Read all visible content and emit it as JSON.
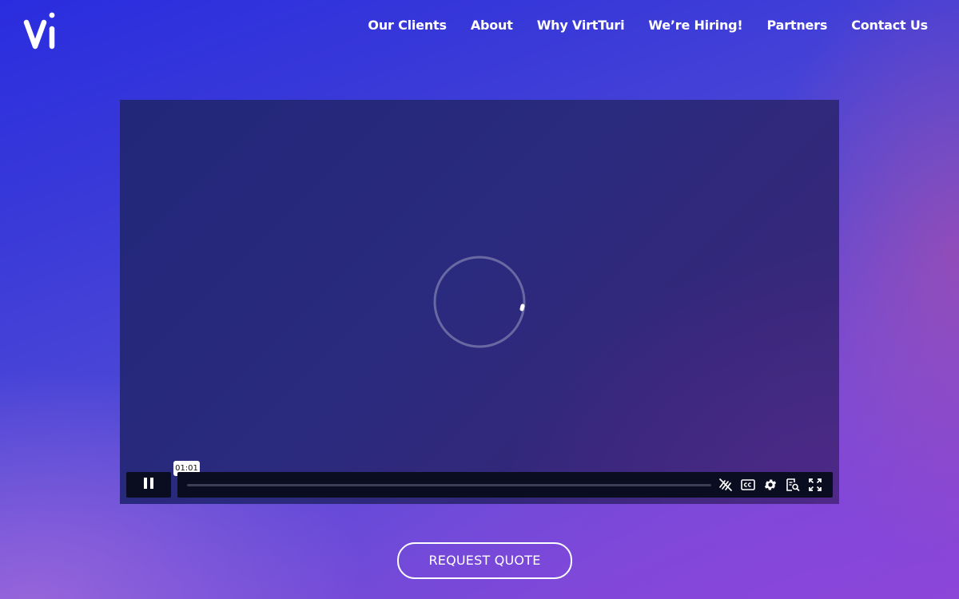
{
  "header": {
    "logo": {
      "text": "vi",
      "icon": "vi-logo"
    },
    "nav": [
      {
        "label": "Our Clients"
      },
      {
        "label": "About"
      },
      {
        "label": "Why VirtTuri"
      },
      {
        "label": "We’re Hiring!"
      },
      {
        "label": "Partners"
      },
      {
        "label": "Contact Us"
      }
    ]
  },
  "video": {
    "state": "loading",
    "loading_icon": "spinner-icon",
    "current_time": "01:01",
    "progress": 0.0,
    "controls": {
      "play_pause_icon": "pause-icon",
      "icons": [
        "reduced-motion-icon",
        "closed-captions-icon",
        "settings-icon",
        "transcript-icon",
        "fullscreen-icon"
      ]
    }
  },
  "cta": {
    "label": "REQUEST QUOTE"
  },
  "colors": {
    "background_top": "#2a2ddf",
    "background_bottom": "#8c45d6",
    "video_bg": "#252879",
    "controls_bg": "#0a0d20",
    "text": "#ffffff"
  }
}
